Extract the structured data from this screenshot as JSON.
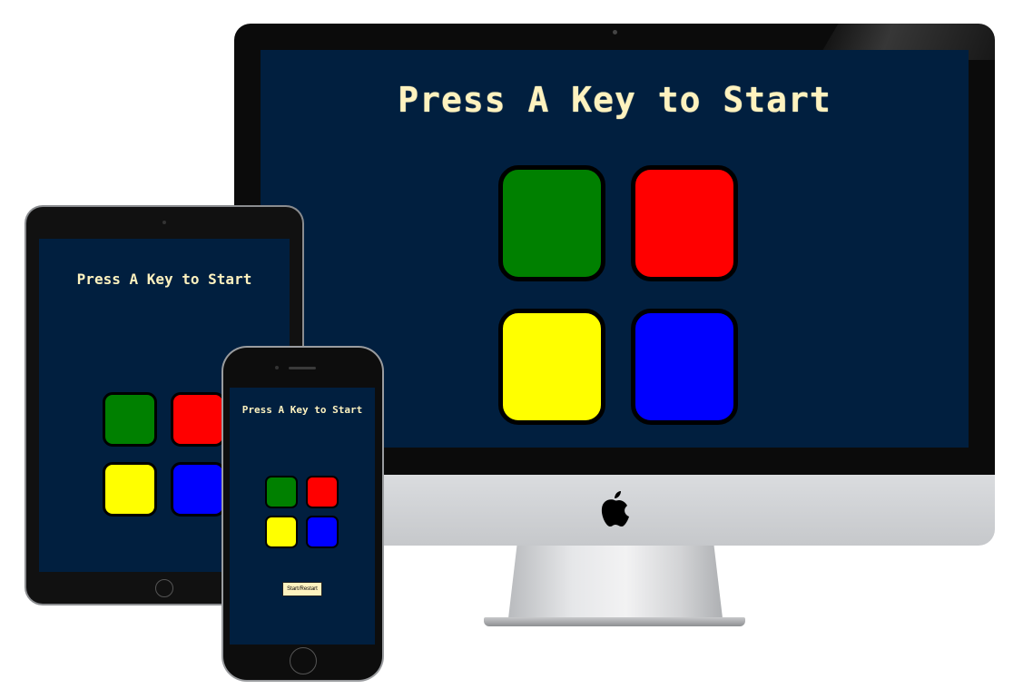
{
  "game": {
    "title": "Press A Key to Start",
    "title_ipad": "Press A Key to Start",
    "title_iphone": "Press A Key to Start",
    "restart_button_label": "Start/Restart",
    "buttons": [
      {
        "name": "green",
        "color": "#008000"
      },
      {
        "name": "red",
        "color": "#ff0000"
      },
      {
        "name": "yellow",
        "color": "#ffff00"
      },
      {
        "name": "blue",
        "color": "#0000ff"
      }
    ]
  },
  "colors": {
    "background": "#011f3f",
    "title_text": "#fef2bf"
  }
}
